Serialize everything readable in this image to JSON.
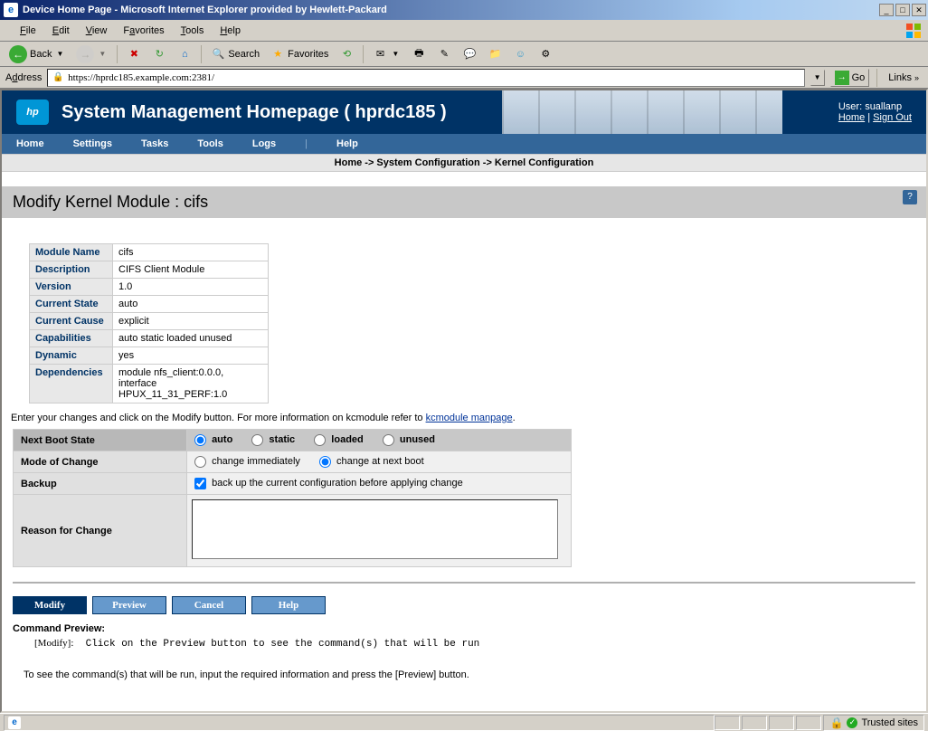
{
  "window": {
    "title": "Device Home Page - Microsoft Internet Explorer provided by Hewlett-Packard"
  },
  "menubar": {
    "file": "File",
    "edit": "Edit",
    "view": "View",
    "favorites": "Favorites",
    "tools": "Tools",
    "help": "Help"
  },
  "toolbar": {
    "back": "Back",
    "search": "Search",
    "favorites": "Favorites"
  },
  "addressbar": {
    "label": "Address",
    "url": "https://hprdc185.example.com:2381/",
    "go": "Go",
    "links": "Links"
  },
  "smh": {
    "title": "System Management Homepage ( hprdc185 )",
    "user_label": "User:",
    "user": "suallanp",
    "home": "Home",
    "signout": "Sign Out",
    "nav": {
      "home": "Home",
      "settings": "Settings",
      "tasks": "Tasks",
      "tools": "Tools",
      "logs": "Logs",
      "help": "Help"
    },
    "breadcrumb": "Home -> System Configuration -> Kernel Configuration"
  },
  "page": {
    "title": "Modify Kernel Module : cifs",
    "info": {
      "module_name_lbl": "Module Name",
      "module_name": "cifs",
      "description_lbl": "Description",
      "description": "CIFS Client Module",
      "version_lbl": "Version",
      "version": "1.0",
      "current_state_lbl": "Current State",
      "current_state": "auto",
      "current_cause_lbl": "Current Cause",
      "current_cause": "explicit",
      "capabilities_lbl": "Capabilities",
      "capabilities": "auto static loaded unused",
      "dynamic_lbl": "Dynamic",
      "dynamic": "yes",
      "dependencies_lbl": "Dependencies",
      "dependencies": "module nfs_client:0.0.0, interface HPUX_11_31_PERF:1.0"
    },
    "instruction_prefix": "Enter your changes and click on the Modify button. For more information on kcmodule refer to ",
    "instruction_link": "kcmodule manpage",
    "form": {
      "next_boot_lbl": "Next Boot State",
      "opt_auto": "auto",
      "opt_static": "static",
      "opt_loaded": "loaded",
      "opt_unused": "unused",
      "mode_lbl": "Mode of Change",
      "opt_immediate": "change immediately",
      "opt_nextboot": "change at next boot",
      "backup_lbl": "Backup",
      "backup_text": "back up the current configuration before applying change",
      "reason_lbl": "Reason for Change",
      "reason_value": ""
    },
    "buttons": {
      "modify": "Modify",
      "preview": "Preview",
      "cancel": "Cancel",
      "help": "Help"
    },
    "cmd": {
      "title": "Command Preview:",
      "label": "[Modify]:",
      "text": "Click on the Preview button to see the command(s) that will be run",
      "hint": "To see the command(s) that will be run, input the required information and press the [Preview] button."
    }
  },
  "statusbar": {
    "trusted": "Trusted sites"
  }
}
